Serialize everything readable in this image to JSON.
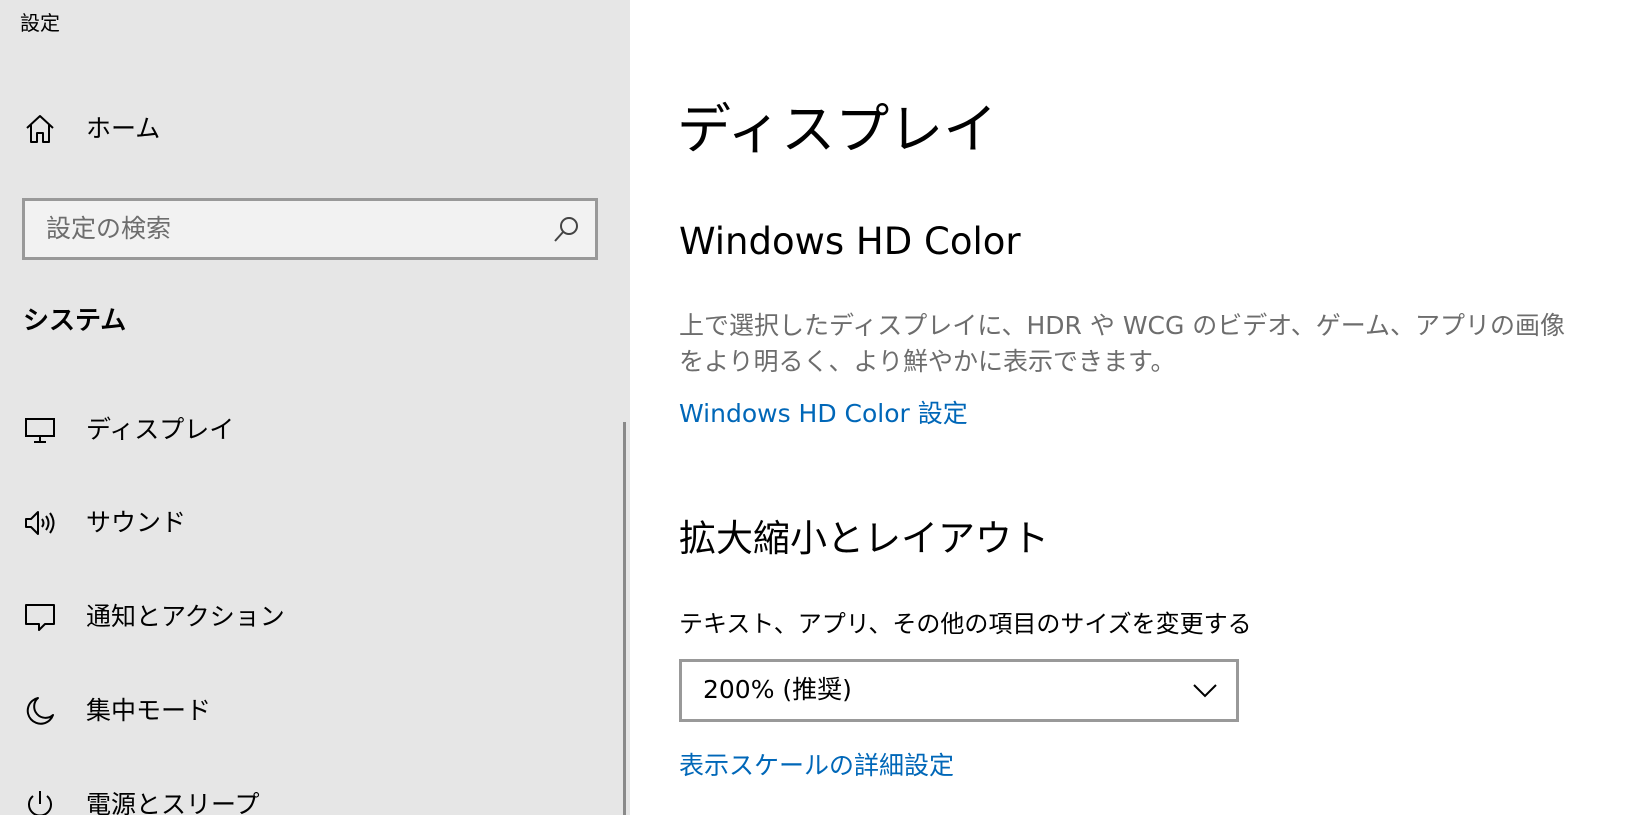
{
  "window": {
    "title": "設定"
  },
  "sidebar": {
    "home": {
      "label": "ホーム",
      "icon": "home-icon"
    },
    "search": {
      "placeholder": "設定の検索",
      "icon": "search-icon"
    },
    "section_header": "システム",
    "items": [
      {
        "label": "ディスプレイ",
        "icon": "monitor-icon"
      },
      {
        "label": "サウンド",
        "icon": "speaker-icon"
      },
      {
        "label": "通知とアクション",
        "icon": "notification-icon"
      },
      {
        "label": "集中モード",
        "icon": "moon-icon"
      },
      {
        "label": "電源とスリープ",
        "icon": "power-icon"
      }
    ]
  },
  "main": {
    "title": "ディスプレイ",
    "hdr": {
      "title": "Windows HD Color",
      "description": "上で選択したディスプレイに、HDR や WCG のビデオ、ゲーム、アプリの画像をより明るく、より鮮やかに表示できます。",
      "link": "Windows HD Color 設定"
    },
    "scale": {
      "title": "拡大縮小とレイアウト",
      "label": "テキスト、アプリ、その他の項目のサイズを変更する",
      "selected_value": "200% (推奨)",
      "link": "表示スケールの詳細設定"
    }
  },
  "colors": {
    "sidebar_bg": "#e6e6e6",
    "link": "#0067b8",
    "secondary_text": "#6d6d6d",
    "border": "#999999"
  }
}
